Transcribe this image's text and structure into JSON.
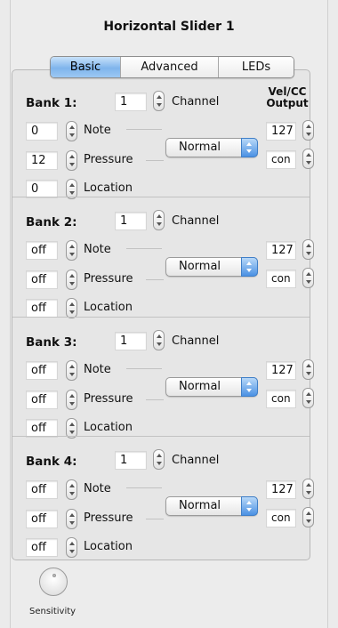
{
  "title": "Horizontal Slider 1",
  "tabs": [
    "Basic",
    "Advanced",
    "LEDs"
  ],
  "vel_header": [
    "Vel/CC",
    "Output"
  ],
  "labels": {
    "channel": "Channel",
    "note": "Note",
    "pressure": "Pressure",
    "location": "Location"
  },
  "banks": [
    {
      "label": "Bank 1:",
      "channel": "1",
      "note": "0",
      "pressure": "12",
      "location": "0",
      "mode": "Normal",
      "vel": "127",
      "cc": "con"
    },
    {
      "label": "Bank 2:",
      "channel": "1",
      "note": "off",
      "pressure": "off",
      "location": "off",
      "mode": "Normal",
      "vel": "127",
      "cc": "con"
    },
    {
      "label": "Bank 3:",
      "channel": "1",
      "note": "off",
      "pressure": "off",
      "location": "off",
      "mode": "Normal",
      "vel": "127",
      "cc": "con"
    },
    {
      "label": "Bank 4:",
      "channel": "1",
      "note": "off",
      "pressure": "off",
      "location": "off",
      "mode": "Normal",
      "vel": "127",
      "cc": "con"
    }
  ],
  "sensitivity_label": "Sensitivity"
}
